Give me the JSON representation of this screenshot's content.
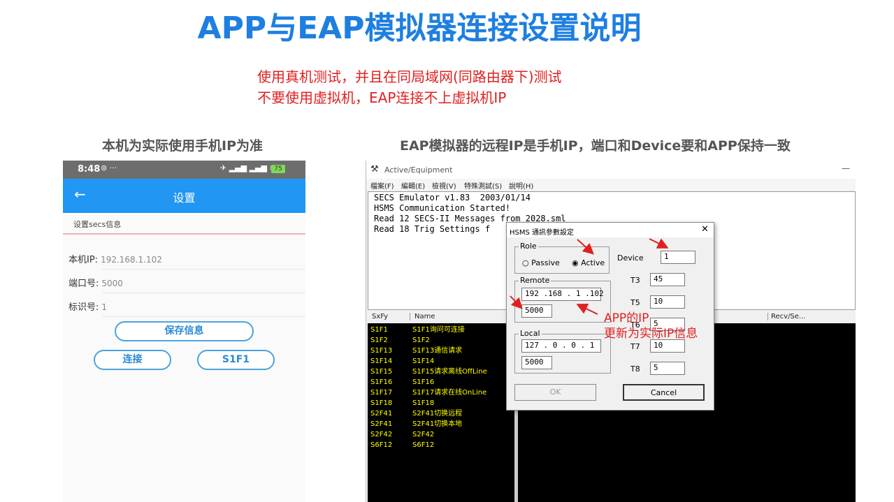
{
  "title": "APP与EAP模拟器连接设置说明",
  "notes": [
    "使用真机测试，并且在同局域网(同路由器下)测试",
    "不要使用虚拟机，EAP连接不上虚拟机IP"
  ],
  "left_heading": "本机为实际使用手机IP为准",
  "right_heading": "EAP模拟器的远程IP是手机IP，端口和Device要和APP保持一致",
  "phone": {
    "status_time": "8:48",
    "status_battery": "75",
    "appbar_title": "设置",
    "section_title": "设置secs信息",
    "fields": [
      {
        "label": "本机IP:",
        "value": "192.168.1.102"
      },
      {
        "label": "端口号:",
        "value": "5000"
      },
      {
        "label": "标识号:",
        "value": "1"
      }
    ],
    "save_button": "保存信息",
    "connect_button": "连接",
    "s1f1_button": "S1F1"
  },
  "app": {
    "window_title": "Active/Equipment",
    "menu": [
      "檔案(F)",
      "編輯(E)",
      "檢視(V)",
      "特殊測試(S)",
      "說明(H)"
    ],
    "console_lines": [
      "SECS Emulator v1.83  2003/01/14",
      "HSMS Communication Started!",
      "Read 12 SECS-II Messages from 2028.sml",
      "Read 18 Trig Settings f"
    ],
    "columns": {
      "sxfy": "SxFy",
      "name": "Name",
      "recv": "Recv/Se..."
    },
    "messages": [
      {
        "sxfy": "S1F1",
        "name": "S1F1询问可连接"
      },
      {
        "sxfy": "S1F2",
        "name": "S1F2"
      },
      {
        "sxfy": "S1F13",
        "name": "S1F13通信请求"
      },
      {
        "sxfy": "S1F14",
        "name": "S1F14"
      },
      {
        "sxfy": "S1F15",
        "name": "S1F15请求离线OffLine"
      },
      {
        "sxfy": "S1F16",
        "name": "S1F16"
      },
      {
        "sxfy": "S1F17",
        "name": "S1F17请求在线OnLine"
      },
      {
        "sxfy": "S1F18",
        "name": "S1F18"
      },
      {
        "sxfy": "S2F41",
        "name": "S2F41切换远程"
      },
      {
        "sxfy": "S2F41",
        "name": "S2F41切换本地"
      },
      {
        "sxfy": "S2F42",
        "name": "S2F42"
      },
      {
        "sxfy": "S6F12",
        "name": "S6F12"
      }
    ]
  },
  "dialog": {
    "title": "HSMS 通訊參數設定",
    "role_label": "Role",
    "passive": "Passive",
    "active": "Active",
    "remote_label": "Remote",
    "remote_ip": "192 .168 . 1  .102",
    "remote_port": "5000",
    "local_label": "Local",
    "local_ip": "127 . 0  . 0  . 1",
    "local_port": "5000",
    "device_label": "Device",
    "device_value": "1",
    "t3_label": "T3",
    "t3_value": "45",
    "t5_label": "T5",
    "t5_value": "10",
    "t6_label": "T6",
    "t6_value": "5",
    "t7_label": "T7",
    "t7_value": "10",
    "t8_label": "T8",
    "t8_value": "5",
    "ok": "OK",
    "cancel": "Cancel"
  },
  "annotation": {
    "line1": "APP的IP",
    "line2": "更新为实际IP信息"
  },
  "colors": {
    "title": "#1e7fe0",
    "note": "#e02020",
    "appbar": "#2196f3",
    "list_text": "#ffff00"
  }
}
